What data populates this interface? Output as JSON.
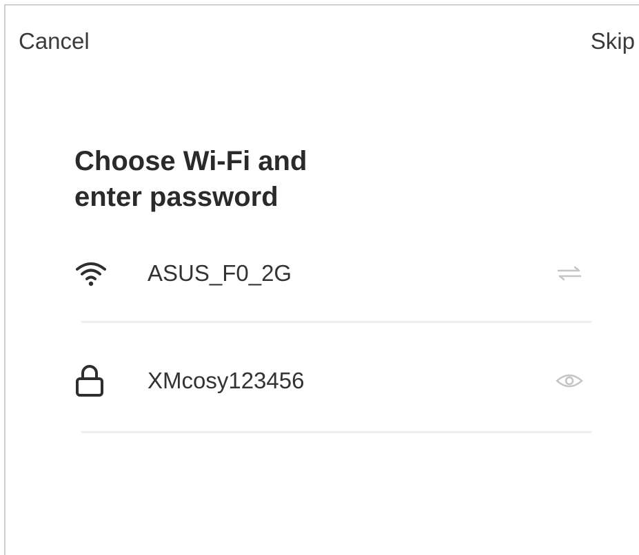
{
  "header": {
    "cancel_label": "Cancel",
    "skip_label": "Skip"
  },
  "main": {
    "title_line1": "Choose Wi-Fi and",
    "title_line2": "enter password",
    "wifi": {
      "icon": "wifi-icon",
      "ssid": "ASUS_F0_2G",
      "action_icon": "switch-network-icon"
    },
    "password": {
      "icon": "lock-icon",
      "value": "XMcosy123456",
      "action_icon": "eye-icon"
    }
  },
  "colors": {
    "text": "#2b2b2b",
    "muted_icon": "#c4c4c4",
    "divider": "#eeeeee"
  }
}
